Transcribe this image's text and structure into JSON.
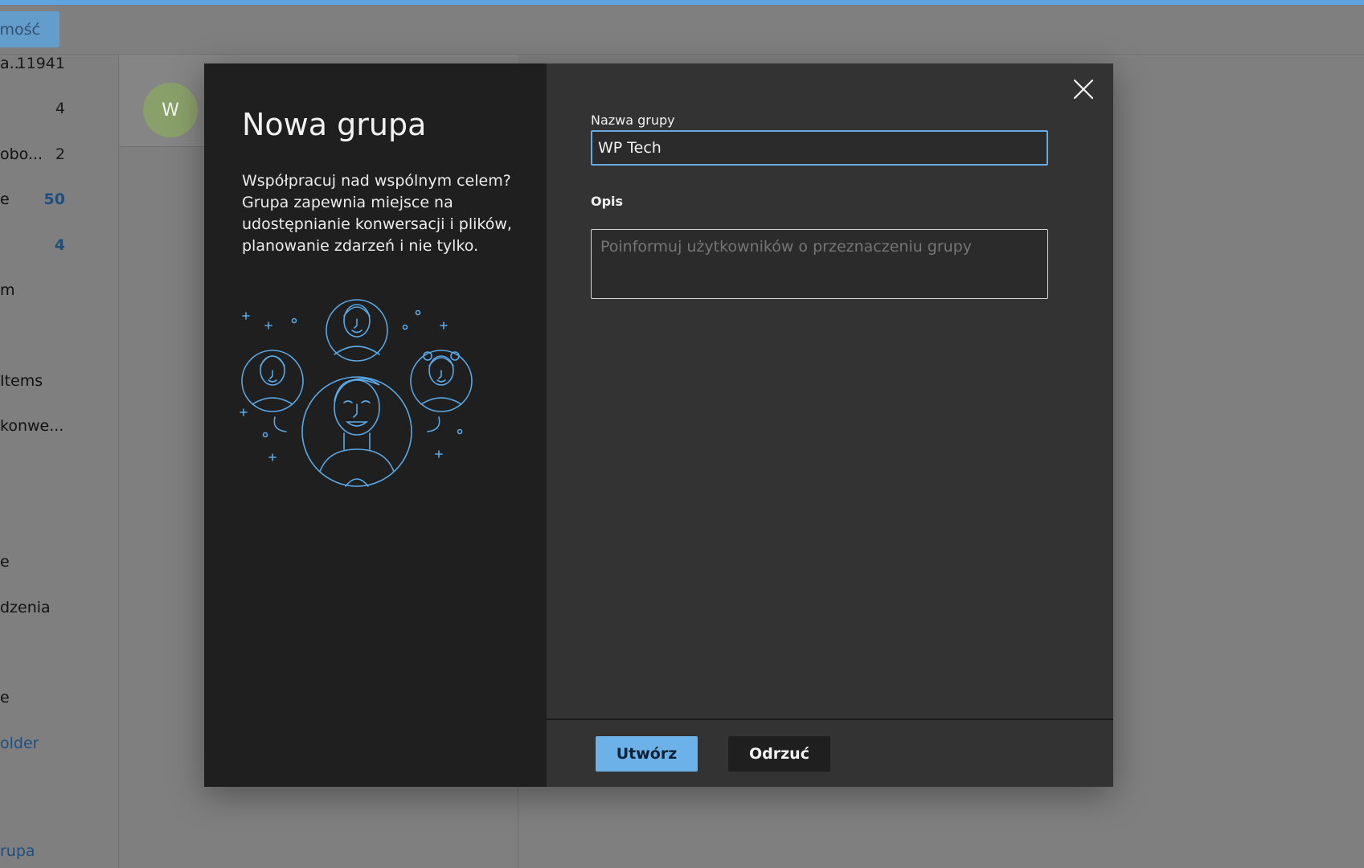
{
  "toolbar": {
    "new_message_label": "omość"
  },
  "sidebar": {
    "folders": [
      {
        "name": "a...",
        "count": "11941"
      },
      {
        "name": "",
        "count": "4"
      },
      {
        "name": "obo...",
        "count": "2"
      },
      {
        "name": "e",
        "count": "50"
      },
      {
        "name": "",
        "count": "4"
      },
      {
        "name": "m",
        "count": ""
      },
      {
        "name": "Items",
        "count": ""
      },
      {
        "name": "konwe...",
        "count": ""
      },
      {
        "name": "e",
        "count": ""
      },
      {
        "name": "dzenia",
        "count": ""
      },
      {
        "name": "e",
        "count": ""
      },
      {
        "name": "older",
        "count": ""
      },
      {
        "name": "rupa",
        "count": ""
      }
    ]
  },
  "message_list": {
    "avatar_initial": "W"
  },
  "modal": {
    "title": "Nowa grupa",
    "description": "Współpracuj nad wspólnym celem? Grupa zapewnia miejsce na udostępnianie konwersacji i plików, planowanie zdarzeń i nie tylko.",
    "name_label": "Nazwa grupy",
    "name_value": "WP Tech",
    "desc_label": "Opis",
    "desc_placeholder": "Poinformuj użytkowników o przeznaczeniu grupy",
    "create_label": "Utwórz",
    "discard_label": "Odrzuć"
  },
  "colors": {
    "accent": "#6cb2e8",
    "illustration_stroke": "#5aa8e6"
  }
}
